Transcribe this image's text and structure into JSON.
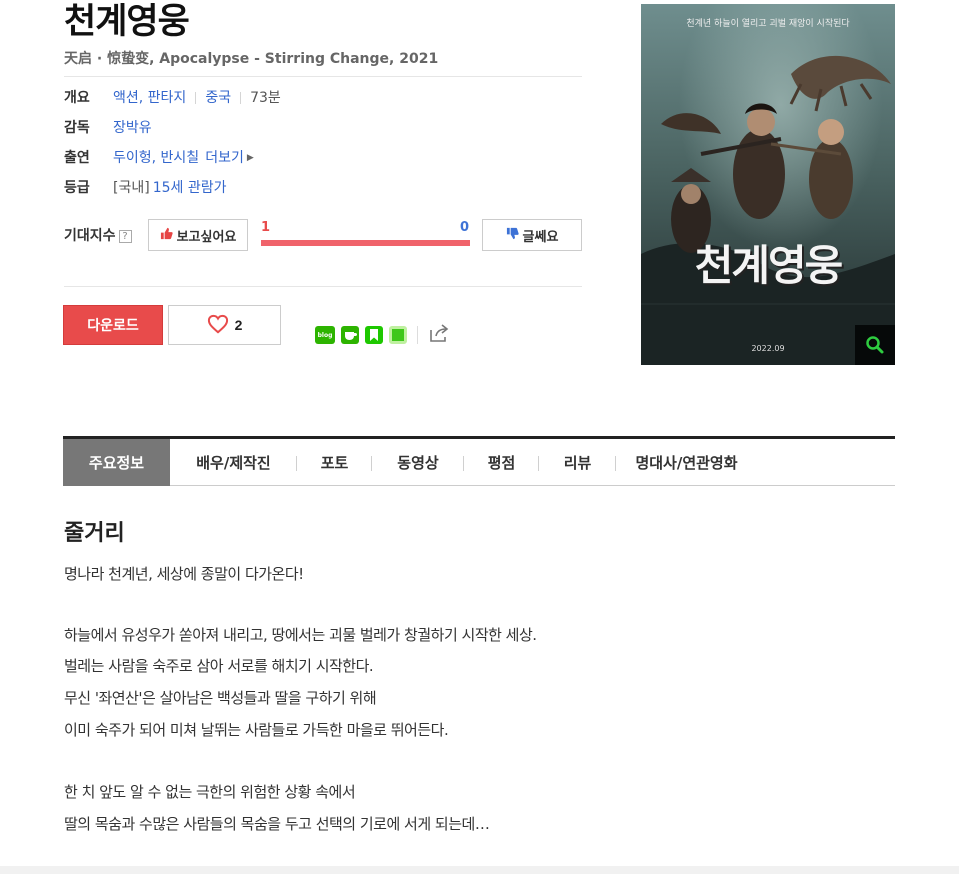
{
  "movie": {
    "title": "천계영웅",
    "subtitle": "天启 · 惊蛰变, Apocalypse - Stirring Change, 2021"
  },
  "info": {
    "overview_label": "개요",
    "genre": "액션, 판타지",
    "country": "중국",
    "runtime": "73분",
    "director_label": "감독",
    "director": "장박유",
    "cast_label": "출연",
    "cast": "두이헝, 반시칠",
    "more_label": "더보기",
    "rating_label": "등급",
    "rating_tag": "[국내]",
    "rating": "15세 관람가"
  },
  "expectation": {
    "label": "기대지수",
    "help": "?",
    "want_label": "보고싶어요",
    "want_count": "1",
    "meh_label": "글쎄요",
    "meh_count": "0",
    "want_ratio": 1.0
  },
  "actions": {
    "download_label": "다운로드",
    "like_count": "2"
  },
  "share": {
    "blog_label": "blog"
  },
  "poster": {
    "top_text": "천계년 하늘이 열리고 괴벌 재앙이 시작된다",
    "title": "천계영웅",
    "date": "2022.09"
  },
  "tabs": [
    {
      "label": "주요정보"
    },
    {
      "label": "배우/제작진"
    },
    {
      "label": "포토"
    },
    {
      "label": "동영상"
    },
    {
      "label": "평점"
    },
    {
      "label": "리뷰"
    },
    {
      "label": "명대사/연관영화"
    }
  ],
  "synopsis": {
    "title": "줄거리",
    "lines": [
      "명나라 천계년, 세상에 종말이 다가온다!",
      "하늘에서 유성우가 쏟아져 내리고, 땅에서는 괴물 벌레가 창궐하기 시작한 세상.",
      "벌레는 사람을 숙주로 삼아 서로를 해치기 시작한다.",
      "무신 '좌연산'은 살아남은 백성들과 딸을 구하기 위해",
      "이미 숙주가 되어 미쳐 날뛰는 사람들로 가득한 마을로 뛰어든다.",
      "한 치 앞도 알 수 없는 극한의 위험한 상황 속에서",
      "딸의 목숨과 수많은 사람들의 목숨을 두고 선택의 기로에 서게 되는데…"
    ]
  },
  "colors": {
    "accent_red": "#e84b4b",
    "link_blue": "#3366cc",
    "tab_active": "#777777"
  }
}
